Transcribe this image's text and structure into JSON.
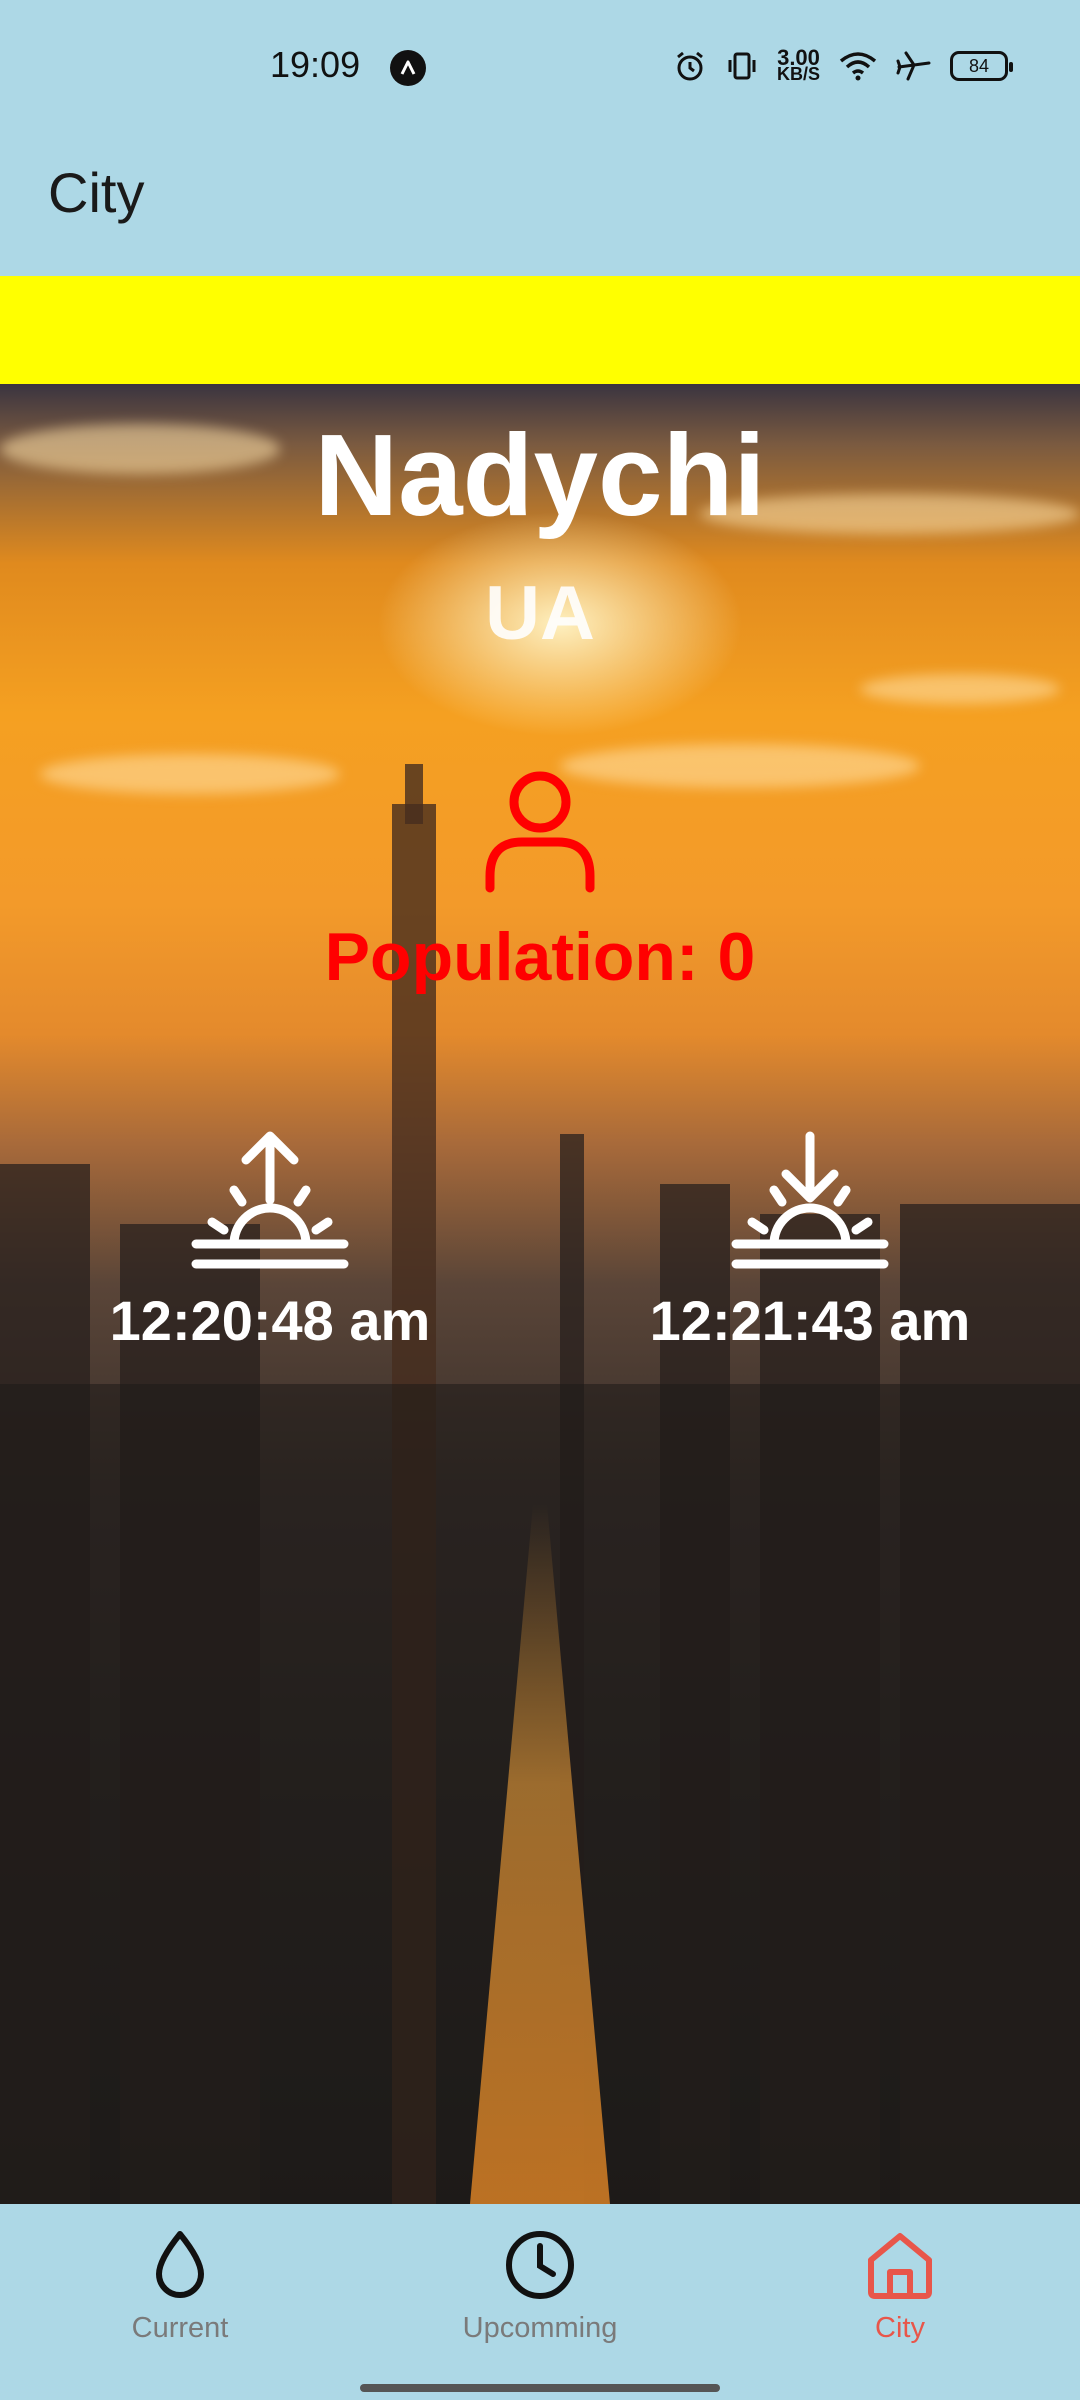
{
  "status_bar": {
    "time": "19:09",
    "net_speed_value": "3.00",
    "net_speed_unit": "KB/S",
    "battery": "84",
    "icons": [
      "app-notification-icon",
      "alarm-icon",
      "vibrate-icon",
      "wifi-icon",
      "airplane-icon",
      "battery-icon"
    ]
  },
  "app_bar": {
    "title": "City"
  },
  "city": {
    "name": "Nadychi",
    "country": "UA",
    "population_label": "Population: 0",
    "sunrise": "12:20:48 am",
    "sunset": "12:21:43 am"
  },
  "colors": {
    "background": "#add8e6",
    "banner": "#ffff00",
    "population": "#ff0000",
    "active_nav": "#e8564a",
    "inactive_nav": "#7a7a7a"
  },
  "nav": {
    "items": [
      {
        "label": "Current",
        "icon": "drop-icon",
        "active": false
      },
      {
        "label": "Upcomming",
        "icon": "clock-icon",
        "active": false
      },
      {
        "label": "City",
        "icon": "home-icon",
        "active": true
      }
    ]
  }
}
